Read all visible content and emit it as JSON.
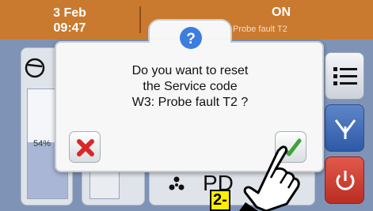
{
  "header": {
    "date": "3 Feb",
    "time": "09:47",
    "status": "ON",
    "fault_text": "Probe fault T2"
  },
  "background": {
    "bar_percent_label": "54%",
    "bar_level": 0.54,
    "bottom_text": "PD"
  },
  "dialog": {
    "icon": "question-icon",
    "message_line1": "Do you want to reset",
    "message_line2": "the Service code",
    "message_line3": "W3: Probe fault T2 ?",
    "cancel_icon": "red-x-icon",
    "confirm_icon": "green-check-icon"
  },
  "side_buttons": [
    "menu-icon",
    "valve-icon",
    "power-icon"
  ],
  "annotation": {
    "step_label": "2-"
  },
  "colors": {
    "header": "#c97a2f",
    "panel": "#7f93b6",
    "dialog": "#f7f7f7",
    "question": "#3d7de0",
    "cancel": "#d8272a",
    "confirm": "#3aa33a",
    "step_label_bg": "#ffee00"
  }
}
